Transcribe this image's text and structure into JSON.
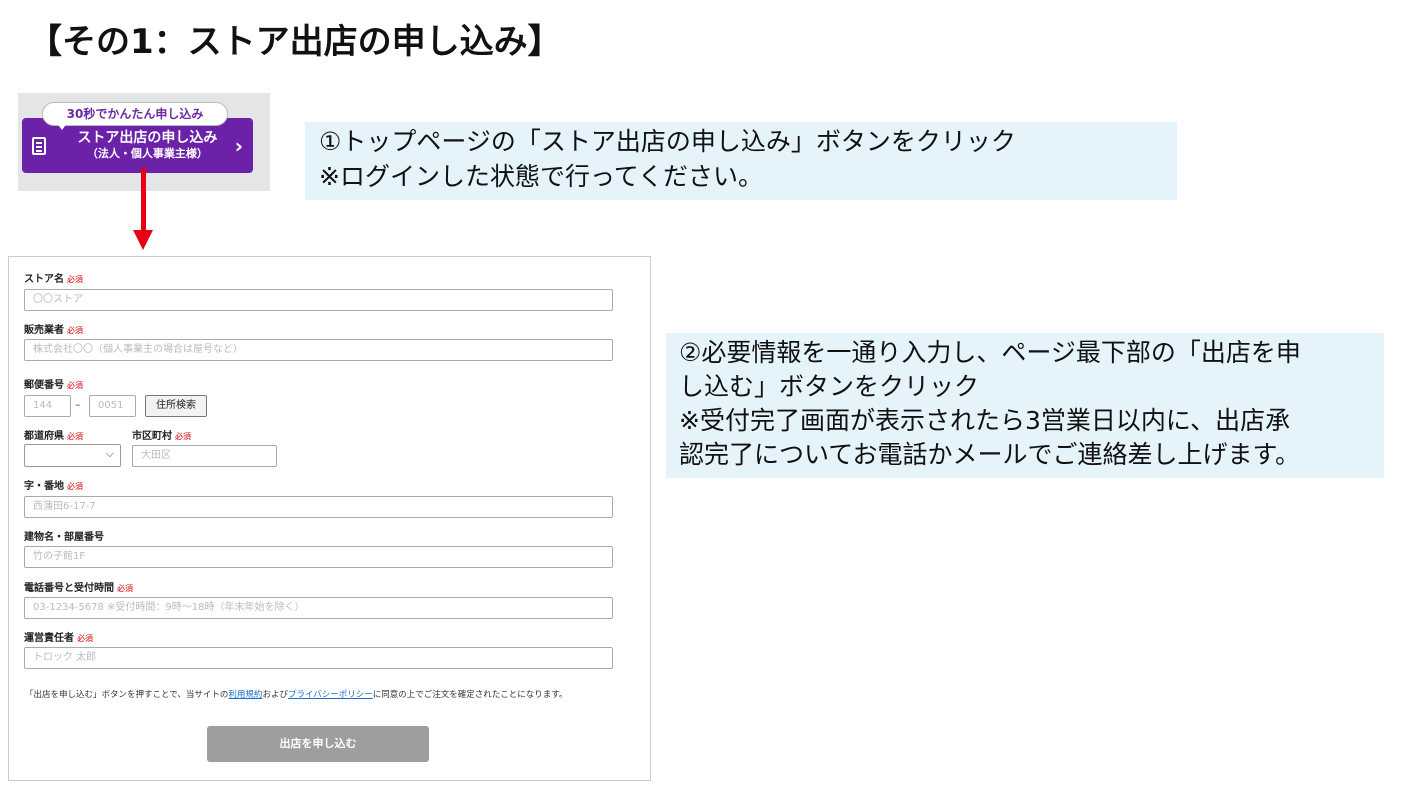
{
  "page_title": "【その1：ストア出店の申し込み】",
  "step1_button": {
    "bubble_text": "30秒でかんたん申し込み",
    "label_line1": "ストア出店の申し込み",
    "label_line2": "（法人・個人事業主様）"
  },
  "note1": {
    "line1": "①トップページの「ストア出店の申し込み」ボタンをクリック",
    "line2": "※ログインした状態で行ってください。"
  },
  "note2": {
    "line1": "②必要情報を一通り入力し、ページ最下部の「出店を申",
    "line2": "し込む」ボタンをクリック",
    "line3": "※受付完了画面が表示されたら3営業日以内に、出店承",
    "line4": "認完了についてお電話かメールでご連絡差し上げます。"
  },
  "form": {
    "required_mark": "必須",
    "store_name": {
      "label": "ストア名",
      "placeholder": "〇〇ストア"
    },
    "seller": {
      "label": "販売業者",
      "placeholder": "株式会社〇〇（個人事業主の場合は屋号など）"
    },
    "postal": {
      "label": "郵便番号",
      "placeholder1": "144",
      "placeholder2": "0051",
      "separator": "–",
      "search_button": "住所検索"
    },
    "prefecture": {
      "label": "都道府県",
      "value": ""
    },
    "city": {
      "label": "市区町村",
      "placeholder": "大田区"
    },
    "address": {
      "label": "字・番地",
      "placeholder": "西蒲田6-17-7"
    },
    "building": {
      "label": "建物名・部屋番号",
      "placeholder": "竹の子館1F"
    },
    "phone": {
      "label": "電話番号と受付時間",
      "placeholder": "03-1234-5678 ※受付時間：9時〜18時（年末年始を除く）"
    },
    "manager": {
      "label": "運営責任者",
      "placeholder": "トロック 太郎"
    },
    "agreement": {
      "before": "「出店を申し込む」ボタンを押すことで、当サイトの",
      "terms_link": "利用規約",
      "middle": "および",
      "privacy_link": "プライバシーポリシー",
      "after": "に同意の上でご注文を確定されたことになります。"
    },
    "submit_label": "出店を申し込む"
  },
  "colors": {
    "purple_button": "#6b21a8",
    "note_background": "#e5f4fb",
    "arrow": "#e60012",
    "required": "#d40000",
    "submit_disabled": "#9e9e9e"
  }
}
